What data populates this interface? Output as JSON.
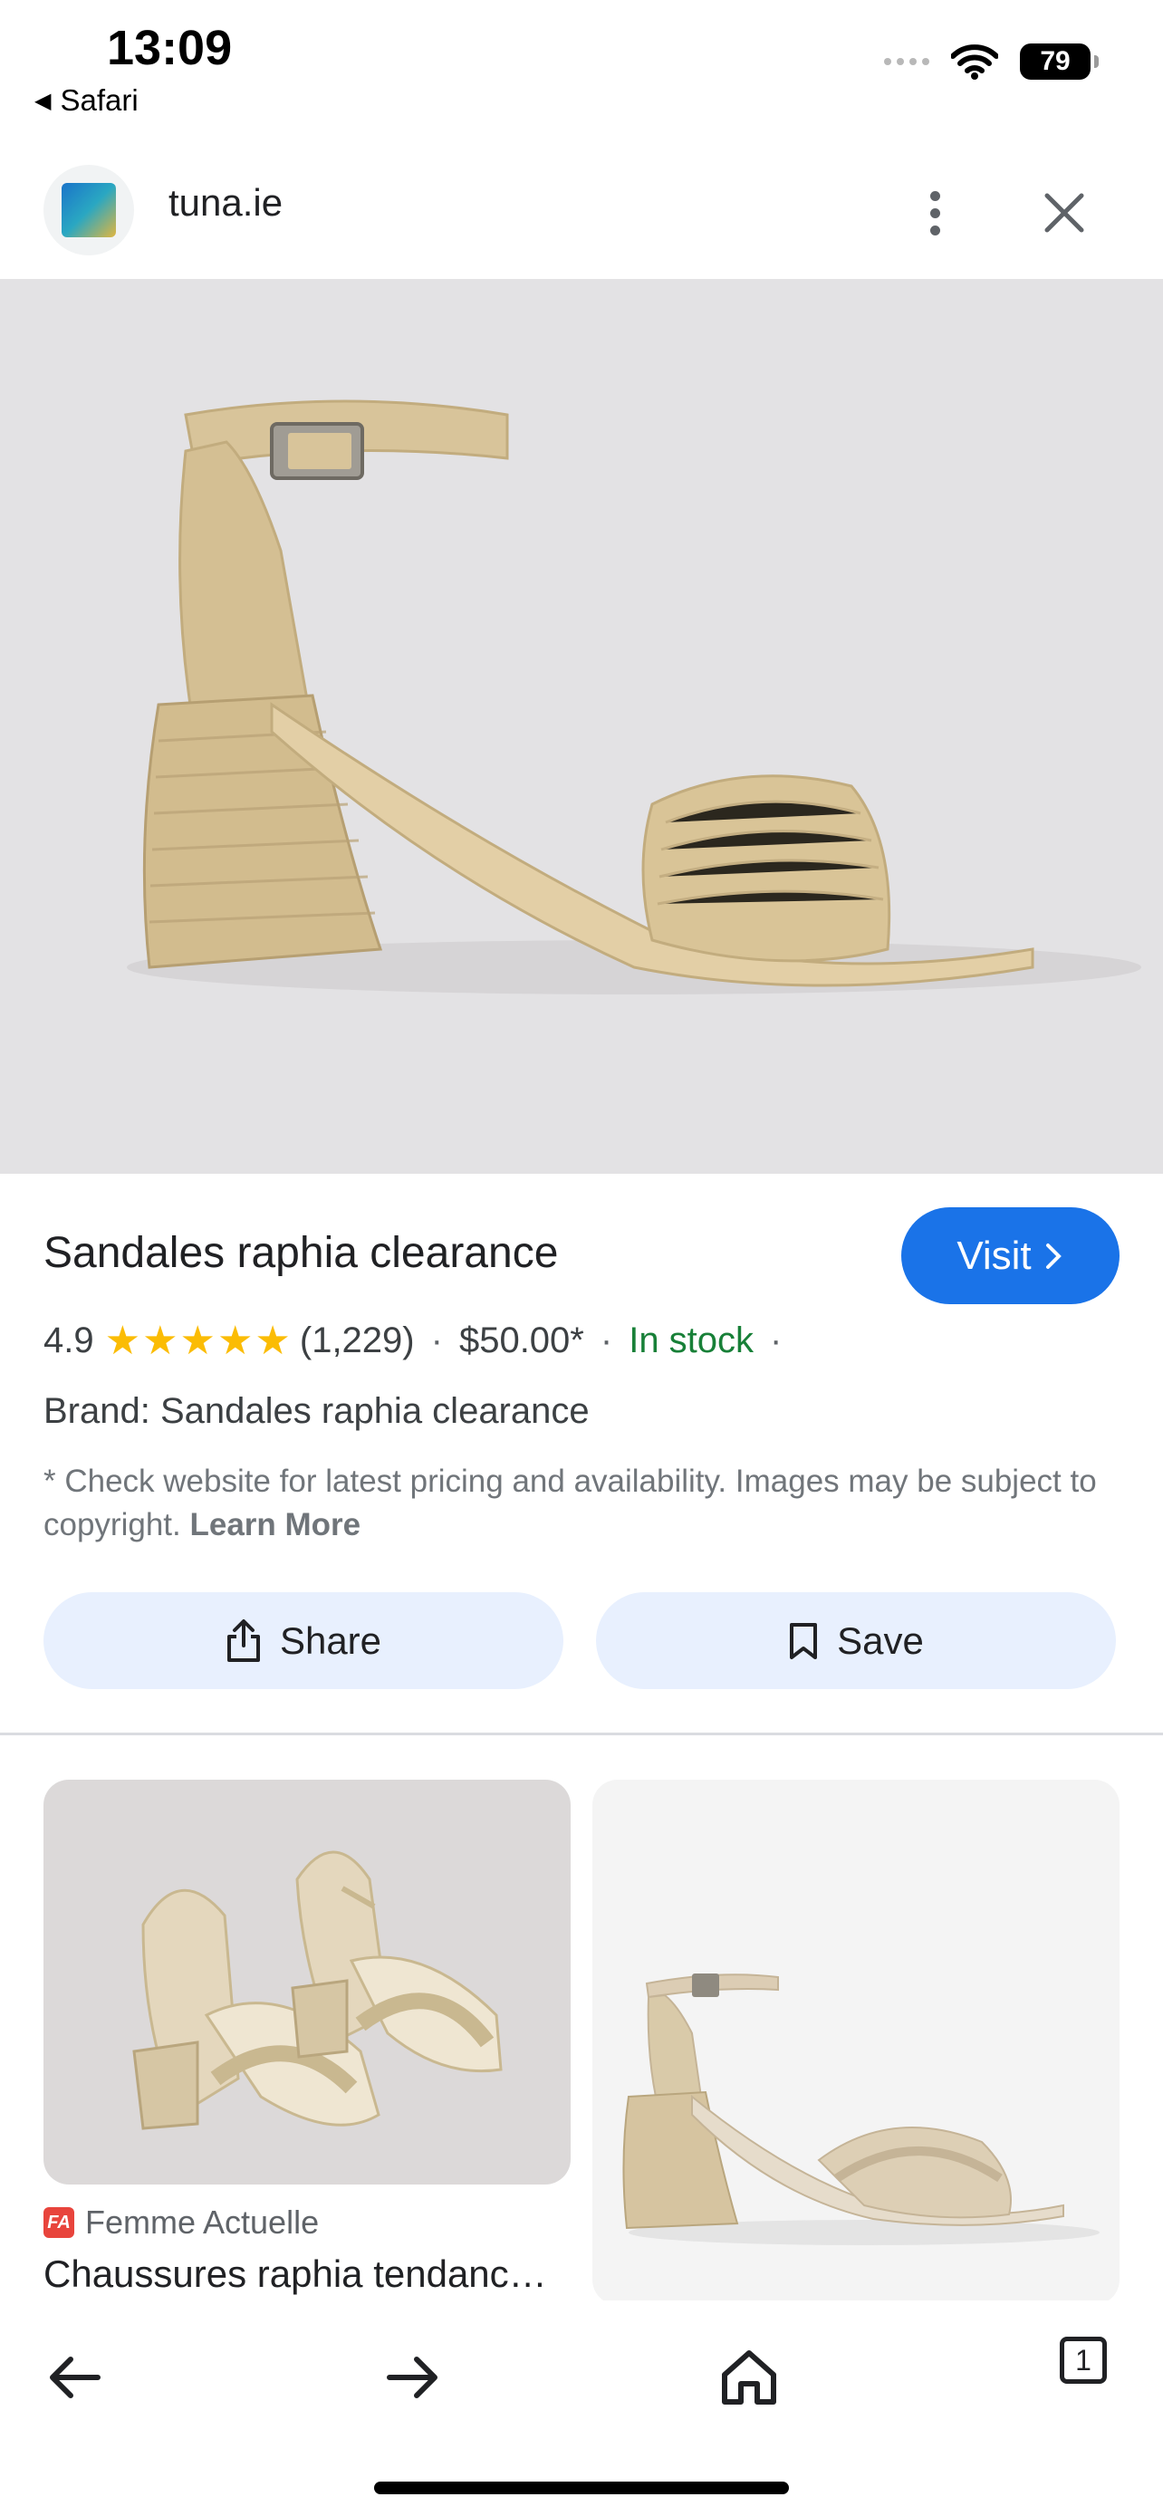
{
  "status_bar": {
    "time": "13:09",
    "back_label": "Safari",
    "battery": "79"
  },
  "header": {
    "site_name": "tuna.ie"
  },
  "product": {
    "title": "Sandales raphia clearance",
    "visit_label": "Visit",
    "rating": "4.9",
    "stars": 5,
    "review_count": "(1,229)",
    "price": "$50.00*",
    "stock": "In stock",
    "brand": "Brand: Sandales raphia clearance",
    "disclaimer": "* Check website for latest pricing and availability. Images may be subject to copyright.",
    "learn_more": "Learn More",
    "share_label": "Share",
    "save_label": "Save"
  },
  "related": [
    {
      "source_icon": "FA",
      "source": "Femme Actuelle",
      "title": "Chaussures raphia tendanc…"
    }
  ],
  "bottom_nav": {
    "tab_count": "1"
  },
  "colors": {
    "accent": "#1a73e8",
    "in_stock": "#188038",
    "star": "#fbbc04",
    "chip_bg": "#e8f0fe"
  }
}
